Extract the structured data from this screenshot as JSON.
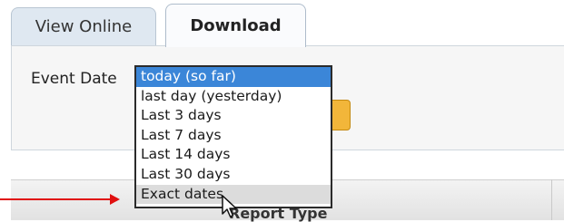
{
  "tabs": [
    {
      "label": "View Online",
      "active": false
    },
    {
      "label": "Download",
      "active": true
    }
  ],
  "form": {
    "event_date_label": "Event Date"
  },
  "event_date_select": {
    "options": [
      "today (so far)",
      "last day (yesterday)",
      "Last 3 days",
      "Last 7 days",
      "Last 14 days",
      "Last 30 days",
      "Exact dates"
    ],
    "selected_index": 0,
    "hovered_index": 6
  },
  "table": {
    "column_header": "Report Type"
  },
  "colors": {
    "selected_option": "#3b86d8",
    "annotation_arrow": "#e01010",
    "button_accent": "#f2b63a"
  }
}
